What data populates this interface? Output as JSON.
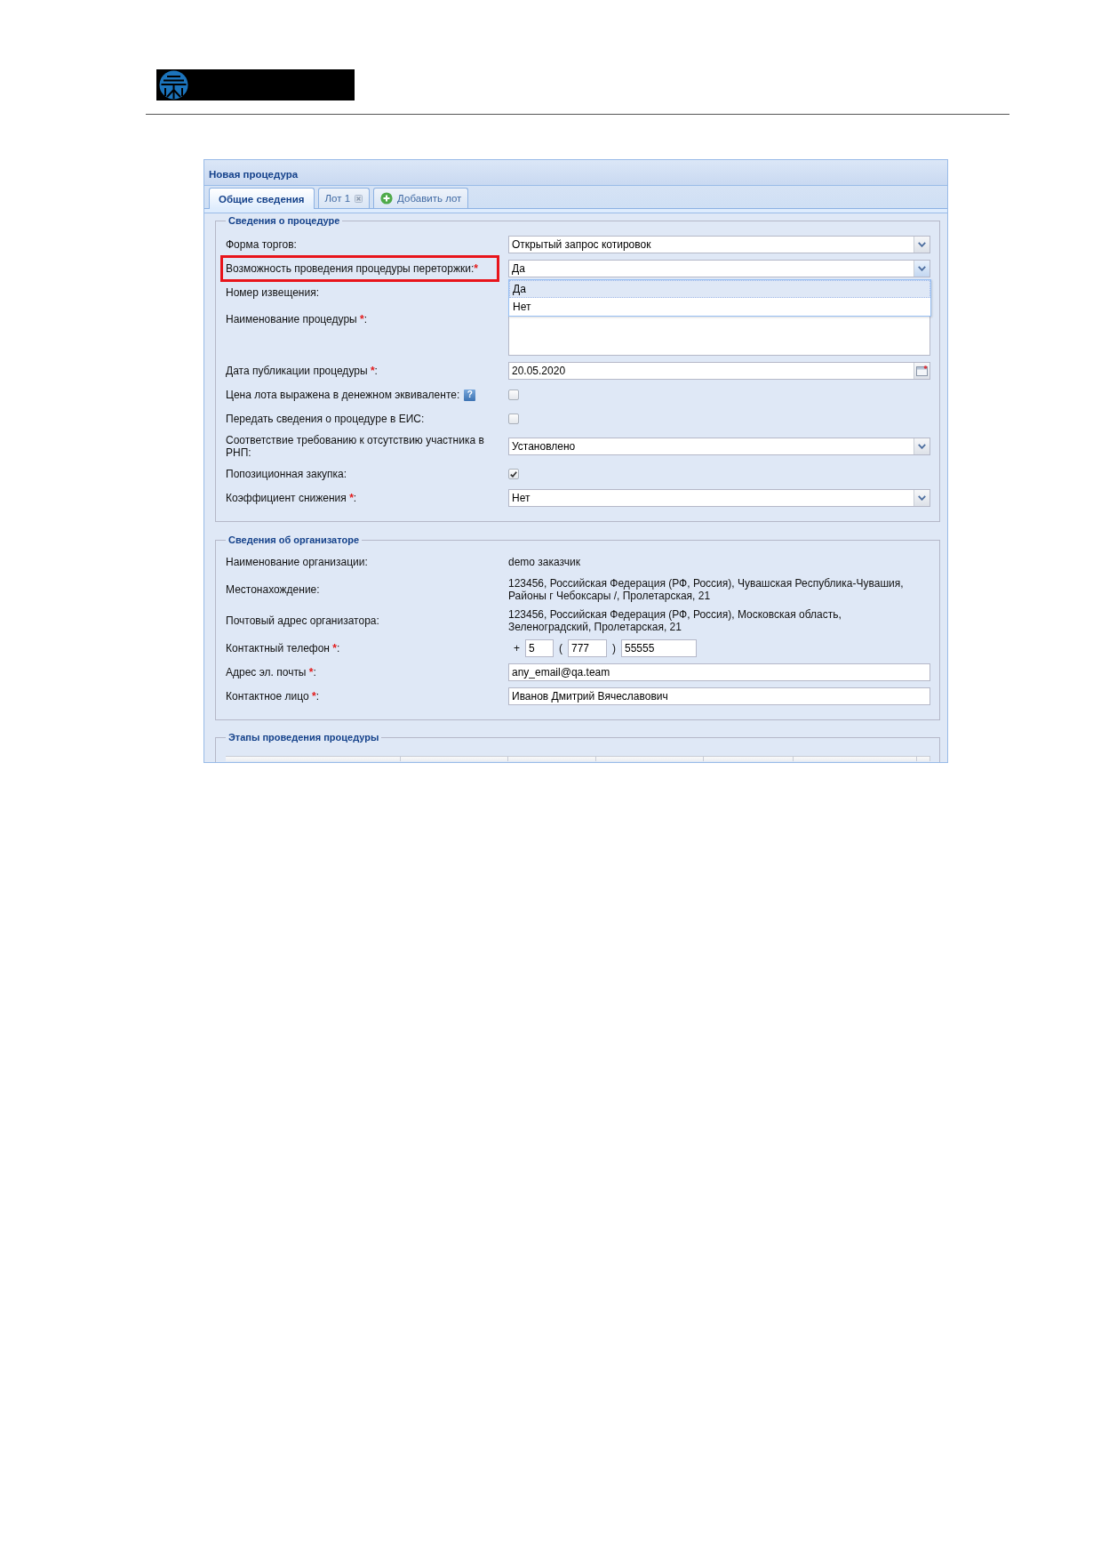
{
  "panel": {
    "title": "Новая процедура"
  },
  "tabs": [
    {
      "kind": "tab",
      "label": "Общие сведения",
      "selected": true
    },
    {
      "kind": "closable",
      "label": "Лот 1",
      "selected": false
    },
    {
      "kind": "add",
      "label": "Добавить лот",
      "selected": false
    }
  ],
  "procedure": {
    "title": "Сведения о процедуре",
    "fields": [
      {
        "label": "Форма торгов:",
        "kind": "select",
        "value": "Открытый запрос котировок",
        "expanded": false,
        "highlighted": false
      },
      {
        "label": "Возможность проведения процедуры переторжки:",
        "mark": "*",
        "kind": "select",
        "value": "Да",
        "expanded": true,
        "highlighted": true,
        "options": [
          {
            "label": "Да",
            "selected": true
          },
          {
            "label": "Нет",
            "selected": false
          }
        ]
      },
      {
        "label": "Номер извещения:",
        "kind": "blank",
        "highlighted": false
      },
      {
        "label": "Наименование процедуры ",
        "mark": "*",
        "label_end": ":",
        "kind": "textarea",
        "highlighted": false
      },
      {
        "label": "Дата публикации процедуры ",
        "mark": "*",
        "label_end": ":",
        "kind": "date",
        "value": "20.05.2020",
        "highlighted": false
      },
      {
        "label": "Цена лота выражена в денежном эквиваленте:",
        "help": "?",
        "kind": "checkbox",
        "checked": false,
        "highlighted": false
      },
      {
        "label": "Передать сведения о процедуре в ЕИС:",
        "kind": "checkbox",
        "checked": false,
        "highlighted": false
      },
      {
        "label": "Соответствие требованию к отсутствию участника в РНП:",
        "kind": "select",
        "value": "Установлено",
        "expanded": false,
        "highlighted": false
      },
      {
        "label": "Попозиционная закупка:",
        "kind": "checkbox",
        "checked": true,
        "highlighted": false
      },
      {
        "label": "Коэффициент снижения ",
        "mark": "*",
        "label_end": ":",
        "kind": "select",
        "value": "Нет",
        "expanded": false,
        "highlighted": false
      }
    ]
  },
  "organizer": {
    "title": "Сведения об организаторе",
    "fields": [
      {
        "label": "Наименование организации:",
        "kind": "static",
        "value": "demo заказчик"
      },
      {
        "label": "Местонахождение:",
        "kind": "static",
        "value": "123456, Российская Федерация (РФ, Россия), Чувашская Республика-Чувашия, Районы г Чебоксары /, Пролетарская, 21"
      },
      {
        "label": "Почтовый адрес организатора:",
        "kind": "static",
        "value": "123456, Российская Федерация (РФ, Россия), Московская область, Зеленоградский, Пролетарская, 21"
      },
      {
        "label": "Контактный телефон ",
        "mark": "*",
        "label_end": ":",
        "kind": "phone",
        "parts": [
          {
            "kind": "sign",
            "text": "+"
          },
          {
            "kind": "input",
            "value": "5"
          },
          {
            "kind": "sign",
            "text": "("
          },
          {
            "kind": "input",
            "value": "777"
          },
          {
            "kind": "sign",
            "text": ")"
          },
          {
            "kind": "input",
            "value": "55555"
          }
        ]
      },
      {
        "label": "Адрес эл. почты ",
        "mark": "*",
        "label_end": ":",
        "kind": "text",
        "value": "any_email@qa.team"
      },
      {
        "label": "Контактное лицо ",
        "mark": "*",
        "label_end": ":",
        "kind": "text",
        "value": "Иванов Дмитрий Вячеславович"
      }
    ]
  },
  "stages": {
    "title": "Этапы проведения процедуры"
  }
}
